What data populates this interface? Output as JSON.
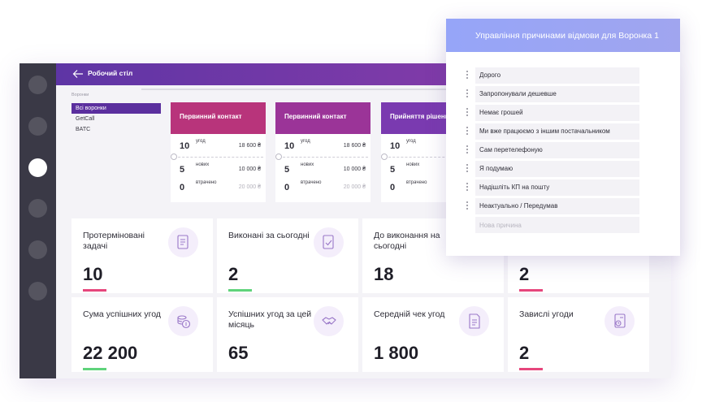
{
  "topbar": {
    "title": "Робочий стіл"
  },
  "funnels": {
    "label": "Воронки",
    "items": [
      {
        "label": "Всі воронки",
        "selected": true
      },
      {
        "label": "GetCall",
        "selected": false
      },
      {
        "label": "BATC",
        "selected": false
      }
    ]
  },
  "stages": [
    {
      "title": "Первинний контакт",
      "color": "#b8347b",
      "rows": [
        {
          "count": "10",
          "label": "угод",
          "amount": "18 600 ₴"
        },
        {
          "count": "5",
          "label": "нових",
          "amount": "10 000 ₴"
        },
        {
          "count": "0",
          "label": "втрачено",
          "amount": "20 000 ₴"
        }
      ]
    },
    {
      "title": "Первинний контакт",
      "color": "#9b3498",
      "rows": [
        {
          "count": "10",
          "label": "угод",
          "amount": "18 600 ₴"
        },
        {
          "count": "5",
          "label": "нових",
          "amount": "10 000 ₴"
        },
        {
          "count": "0",
          "label": "втрачено",
          "amount": "20 000 ₴"
        }
      ]
    },
    {
      "title": "Прийняття рішення",
      "color": "#7a3ab0",
      "rows": [
        {
          "count": "10",
          "label": "угод",
          "amount": ""
        },
        {
          "count": "5",
          "label": "нових",
          "amount": ""
        },
        {
          "count": "0",
          "label": "втрачено",
          "amount": ""
        }
      ]
    }
  ],
  "kpis": [
    {
      "title": "Протерміновані задачі",
      "value": "10",
      "bar_color": "#e6467c",
      "icon": "task-list-icon"
    },
    {
      "title": "Виконані за сьогодні",
      "value": "2",
      "bar_color": "#5fd37b",
      "icon": "task-done-icon"
    },
    {
      "title": "До виконання на сьогодні",
      "value": "18",
      "bar_color": "",
      "icon": ""
    },
    {
      "title": "",
      "value": "2",
      "bar_color": "#e6467c",
      "icon": ""
    },
    {
      "title": "Сума успішних угод",
      "value": "22 200",
      "bar_color": "#5fd37b",
      "icon": "coins-icon"
    },
    {
      "title": "Успішних угод за цей місяць",
      "value": "65",
      "bar_color": "",
      "icon": "handshake-icon"
    },
    {
      "title": "Середній чек угод",
      "value": "1 800",
      "bar_color": "",
      "icon": "receipt-icon"
    },
    {
      "title": "Завислі угоди",
      "value": "2",
      "bar_color": "#e6467c",
      "icon": "stuck-deal-icon"
    }
  ],
  "popup": {
    "title": "Управління причинами відмови для Воронка 1",
    "reasons": [
      "Дорого",
      "Запропонували дешевше",
      "Немає грошей",
      "Ми вже працюємо з іншим постачальником",
      "Сам перетелефоную",
      "Я подумаю",
      "Надішліть КП на пошту",
      "Неактуально / Передумав"
    ],
    "new_reason_placeholder": "Нова причина"
  }
}
